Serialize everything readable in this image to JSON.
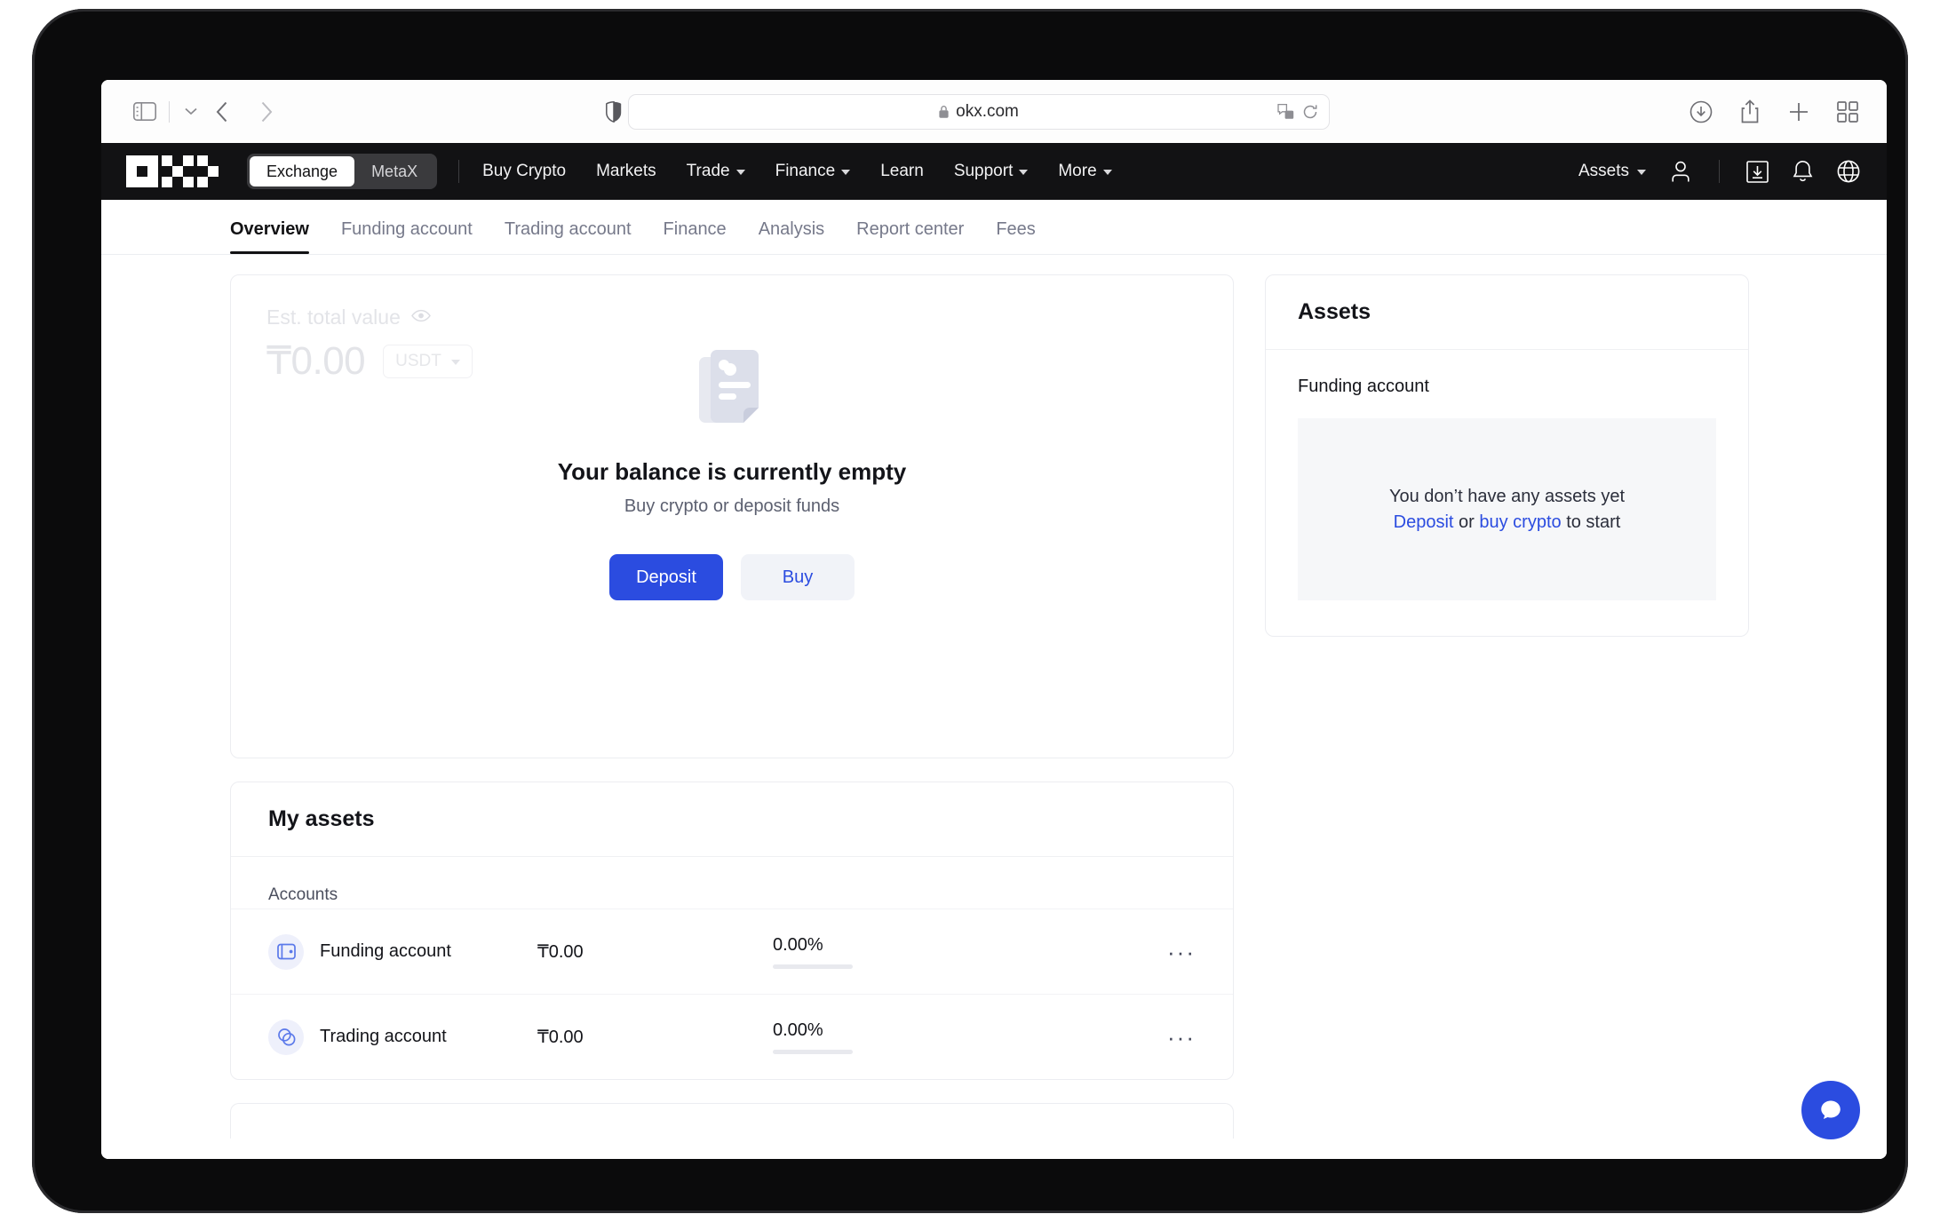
{
  "browser": {
    "url": "okx.com",
    "lock_icon": "lock-icon",
    "shield_icon": "shield-icon",
    "translate_icon": "translate-icon",
    "reload_icon": "reload-icon",
    "sidebar_icon": "sidebar-toggle-icon",
    "back_icon": "back-arrow-icon",
    "forward_icon": "forward-arrow-icon",
    "downloads_icon": "downloads-icon",
    "share_icon": "share-icon",
    "newtab_icon": "new-tab-icon",
    "taboverview_icon": "tab-overview-icon"
  },
  "header": {
    "logo": "okx-logo",
    "mode_switch": [
      {
        "label": "Exchange",
        "active": true
      },
      {
        "label": "MetaX",
        "active": false
      }
    ],
    "nav": [
      {
        "label": "Buy Crypto",
        "caret": false
      },
      {
        "label": "Markets",
        "caret": false
      },
      {
        "label": "Trade",
        "caret": true
      },
      {
        "label": "Finance",
        "caret": true
      },
      {
        "label": "Learn",
        "caret": false
      },
      {
        "label": "Support",
        "caret": true
      },
      {
        "label": "More",
        "caret": true
      }
    ],
    "assets_menu": "Assets",
    "icons": {
      "profile": "user-icon",
      "download_app": "download-app-icon",
      "notifications": "bell-icon",
      "language": "globe-icon"
    }
  },
  "subnav": {
    "tabs": [
      {
        "label": "Overview",
        "active": true
      },
      {
        "label": "Funding account",
        "active": false
      },
      {
        "label": "Trading account",
        "active": false
      },
      {
        "label": "Finance",
        "active": false
      },
      {
        "label": "Analysis",
        "active": false
      },
      {
        "label": "Report center",
        "active": false
      },
      {
        "label": "Fees",
        "active": false
      }
    ]
  },
  "balance_card": {
    "est_label": "Est. total value",
    "eye_icon": "eye-icon",
    "value": "₸0.00",
    "currency": "USDT",
    "chevron_icon": "chevron-down-icon",
    "illustration_icon": "empty-document-icon",
    "empty_title": "Your balance is currently empty",
    "empty_subtitle": "Buy crypto or deposit funds",
    "deposit_button": "Deposit",
    "buy_button": "Buy"
  },
  "my_assets": {
    "title": "My assets",
    "section_label": "Accounts",
    "rows": [
      {
        "icon": "wallet-icon",
        "name": "Funding account",
        "value": "₸0.00",
        "percent": "0.00%",
        "more": "···"
      },
      {
        "icon": "coins-icon",
        "name": "Trading account",
        "value": "₸0.00",
        "percent": "0.00%",
        "more": "···"
      }
    ]
  },
  "assets_panel": {
    "title": "Assets",
    "funding_title": "Funding account",
    "empty_line1": "You don’t have any assets yet",
    "empty_line2_pre": "",
    "empty_deposit_link": "Deposit",
    "empty_or": " or ",
    "empty_buy_link": "buy crypto",
    "empty_suffix": " to start"
  },
  "chat": {
    "icon": "chat-bubble-icon"
  },
  "colors": {
    "accent": "#2b4ce0",
    "header_bg": "#121214",
    "text_primary": "#131419",
    "text_muted": "#76798a"
  }
}
